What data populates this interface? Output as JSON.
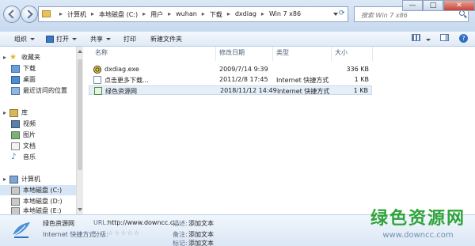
{
  "address": {
    "crumbs": [
      "计算机",
      "本地磁盘 (C:)",
      "用户",
      "wuhan",
      "下载",
      "dxdiag",
      "Win 7 x86"
    ]
  },
  "search": {
    "placeholder": "搜索 Win 7 x86"
  },
  "window_controls": [
    "—",
    "□",
    "✕"
  ],
  "toolbar": {
    "organize": "组织",
    "open": "打开",
    "share": "共享",
    "print": "打印",
    "new_folder": "新建文件夹"
  },
  "nav": {
    "favorites": "收藏夹",
    "downloads": "下载",
    "desktop": "桌面",
    "recent": "最近访问的位置",
    "libraries": "库",
    "videos": "视频",
    "pictures": "图片",
    "documents": "文档",
    "music": "音乐",
    "computer": "计算机",
    "drive_c": "本地磁盘 (C:)",
    "drive_d": "本地磁盘 (D:)",
    "drive_e": "本地磁盘 (E:)"
  },
  "columns": {
    "name": "名称",
    "date": "修改日期",
    "type": "类型",
    "size": "大小"
  },
  "files": [
    {
      "name": "dxdiag.exe",
      "date": "2009/7/14 9:39",
      "type": "",
      "size": "336 KB"
    },
    {
      "name": "点击更多下载...",
      "date": "2011/2/8 17:45",
      "type": "Internet 快捷方式",
      "size": "1 KB"
    },
    {
      "name": "绿色资源网",
      "date": "2018/11/12 14:49",
      "type": "Internet 快捷方式",
      "size": "1 KB"
    }
  ],
  "details": {
    "name": "绿色资源网",
    "type": "Internet 快捷方式",
    "url_label": "URL:",
    "url_value": "http://www.downcc.c...",
    "rating_label": "分级:",
    "rating": "☆☆☆☆☆",
    "desc_label": "描述:",
    "desc_value": "添加文本",
    "comment_label": "备注:",
    "comment_value": "添加文本",
    "tags_label": "标记:",
    "tags_value": "添加文本"
  },
  "watermark": {
    "title": "绿色资源网",
    "url": "www.downcc.com"
  },
  "colors": {
    "accent": "#2fa43a",
    "selection": "#d7e6f7"
  }
}
